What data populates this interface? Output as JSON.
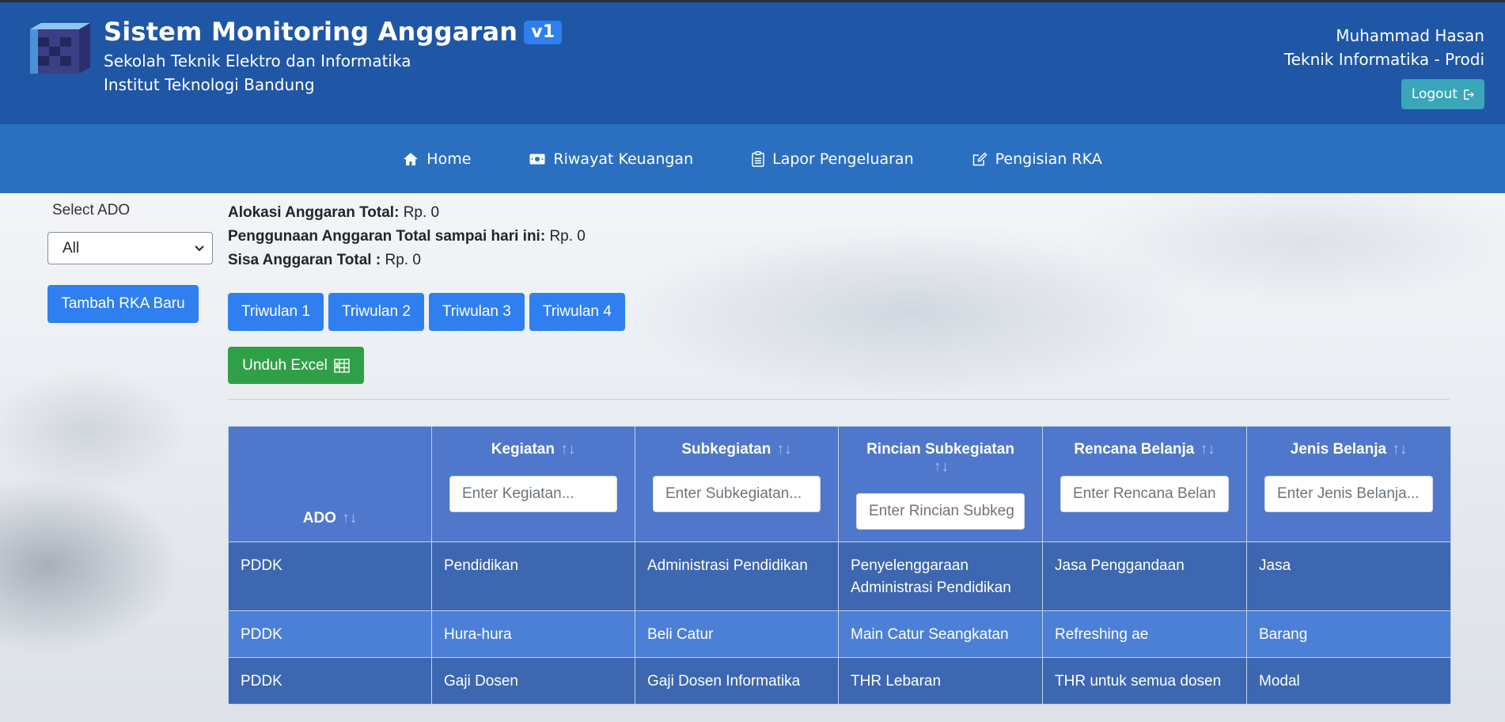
{
  "header": {
    "app_title": "Sistem Monitoring Anggaran",
    "version": "v1",
    "subtitle_line1": "Sekolah Teknik Elektro dan Informatika",
    "subtitle_line2": "Institut Teknologi Bandung",
    "user_name": "Muhammad Hasan",
    "user_unit": "Teknik Informatika - Prodi",
    "logout_label": "Logout"
  },
  "nav": {
    "items": [
      {
        "label": "Home",
        "icon": "home-icon"
      },
      {
        "label": "Riwayat Keuangan",
        "icon": "money-icon"
      },
      {
        "label": "Lapor Pengeluaran",
        "icon": "clipboard-icon"
      },
      {
        "label": "Pengisian RKA",
        "icon": "edit-icon"
      }
    ]
  },
  "sidebar": {
    "select_label": "Select ADO",
    "select_value": "All",
    "add_button": "Tambah RKA Baru"
  },
  "summary": {
    "alokasi_label": "Alokasi Anggaran Total:",
    "alokasi_value": "Rp. 0",
    "penggunaan_label": "Penggunaan Anggaran Total sampai hari ini:",
    "penggunaan_value": "Rp. 0",
    "sisa_label": "Sisa Anggaran Total :",
    "sisa_value": "Rp. 0"
  },
  "triwulan": [
    "Triwulan 1",
    "Triwulan 2",
    "Triwulan 3",
    "Triwulan 4"
  ],
  "excel_button": "Unduh Excel",
  "sort_symbol": "↑↓",
  "table": {
    "columns": [
      {
        "label": "ADO",
        "placeholder": ""
      },
      {
        "label": "Kegiatan",
        "placeholder": "Enter Kegiatan..."
      },
      {
        "label": "Subkegiatan",
        "placeholder": "Enter Subkegiatan..."
      },
      {
        "label": "Rincian Subkegiatan",
        "placeholder": "Enter Rincian Subkeg"
      },
      {
        "label": "Rencana Belanja",
        "placeholder": "Enter Rencana Belan"
      },
      {
        "label": "Jenis Belanja",
        "placeholder": "Enter Jenis Belanja..."
      }
    ],
    "rows": [
      [
        "PDDK",
        "Pendidikan",
        "Administrasi Pendidikan",
        "Penyelenggaraan Administrasi Pendidikan",
        "Jasa Penggandaan",
        "Jasa"
      ],
      [
        "PDDK",
        "Hura-hura",
        "Beli Catur",
        "Main Catur Seangkatan",
        "Refreshing ae",
        "Barang"
      ],
      [
        "PDDK",
        "Gaji Dosen",
        "Gaji Dosen Informatika",
        "THR Lebaran",
        "THR untuk semua dosen",
        "Modal"
      ]
    ]
  },
  "colors": {
    "header_bg": "#1f56a6",
    "nav_bg": "#2b6fc1",
    "primary": "#2f7ff0",
    "success": "#30a046",
    "info": "#3aa6b9",
    "table_head": "#4f78cc",
    "row_dark": "#3d67b0",
    "row_light": "#4c80d6"
  }
}
